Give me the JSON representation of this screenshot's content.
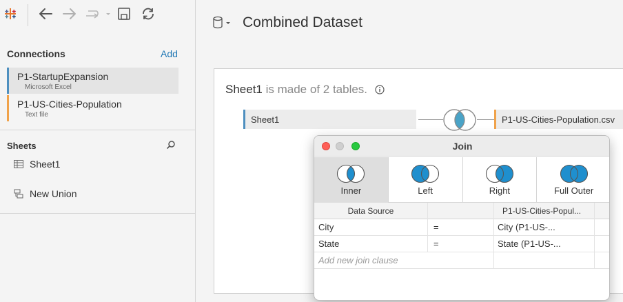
{
  "sidebar": {
    "connections_title": "Connections",
    "add_label": "Add",
    "connections": [
      {
        "name": "P1-StartupExpansion",
        "type": "Microsoft Excel",
        "color": "#4e8fbf"
      },
      {
        "name": "P1-US-Cities-Population",
        "type": "Text file",
        "color": "#f0a24a"
      }
    ],
    "sheets_title": "Sheets",
    "sheets": [
      {
        "name": "Sheet1",
        "icon": "table-icon"
      },
      {
        "name": "New Union",
        "icon": "union-icon"
      }
    ]
  },
  "toolbar": {
    "icons": [
      "tableau-logo-icon",
      "back-arrow-icon",
      "forward-arrow-icon",
      "redo-dropdown-icon",
      "save-icon",
      "refresh-icon"
    ]
  },
  "main": {
    "datasource_title": "Combined Dataset",
    "made_of_name": "Sheet1",
    "made_of_rest": " is made of 2 tables.",
    "left_table": "Sheet1",
    "right_table": "P1-US-Cities-Population.csv"
  },
  "join_dialog": {
    "title": "Join",
    "join_types": [
      {
        "label": "Inner",
        "selected": true
      },
      {
        "label": "Left",
        "selected": false
      },
      {
        "label": "Right",
        "selected": false
      },
      {
        "label": "Full Outer",
        "selected": false
      }
    ],
    "header": {
      "left": "Data Source",
      "right": "P1-US-Cities-Popul..."
    },
    "clauses": [
      {
        "left": "City",
        "op": "=",
        "right": "City (P1-US-..."
      },
      {
        "left": "State",
        "op": "=",
        "right": "State (P1-US-..."
      }
    ],
    "add_clause_placeholder": "Add new join clause"
  },
  "colors": {
    "accent_blue": "#1f8fce",
    "excel_bar": "#4e8fbf",
    "csv_bar": "#f0a24a",
    "link": "#1f77b4"
  }
}
